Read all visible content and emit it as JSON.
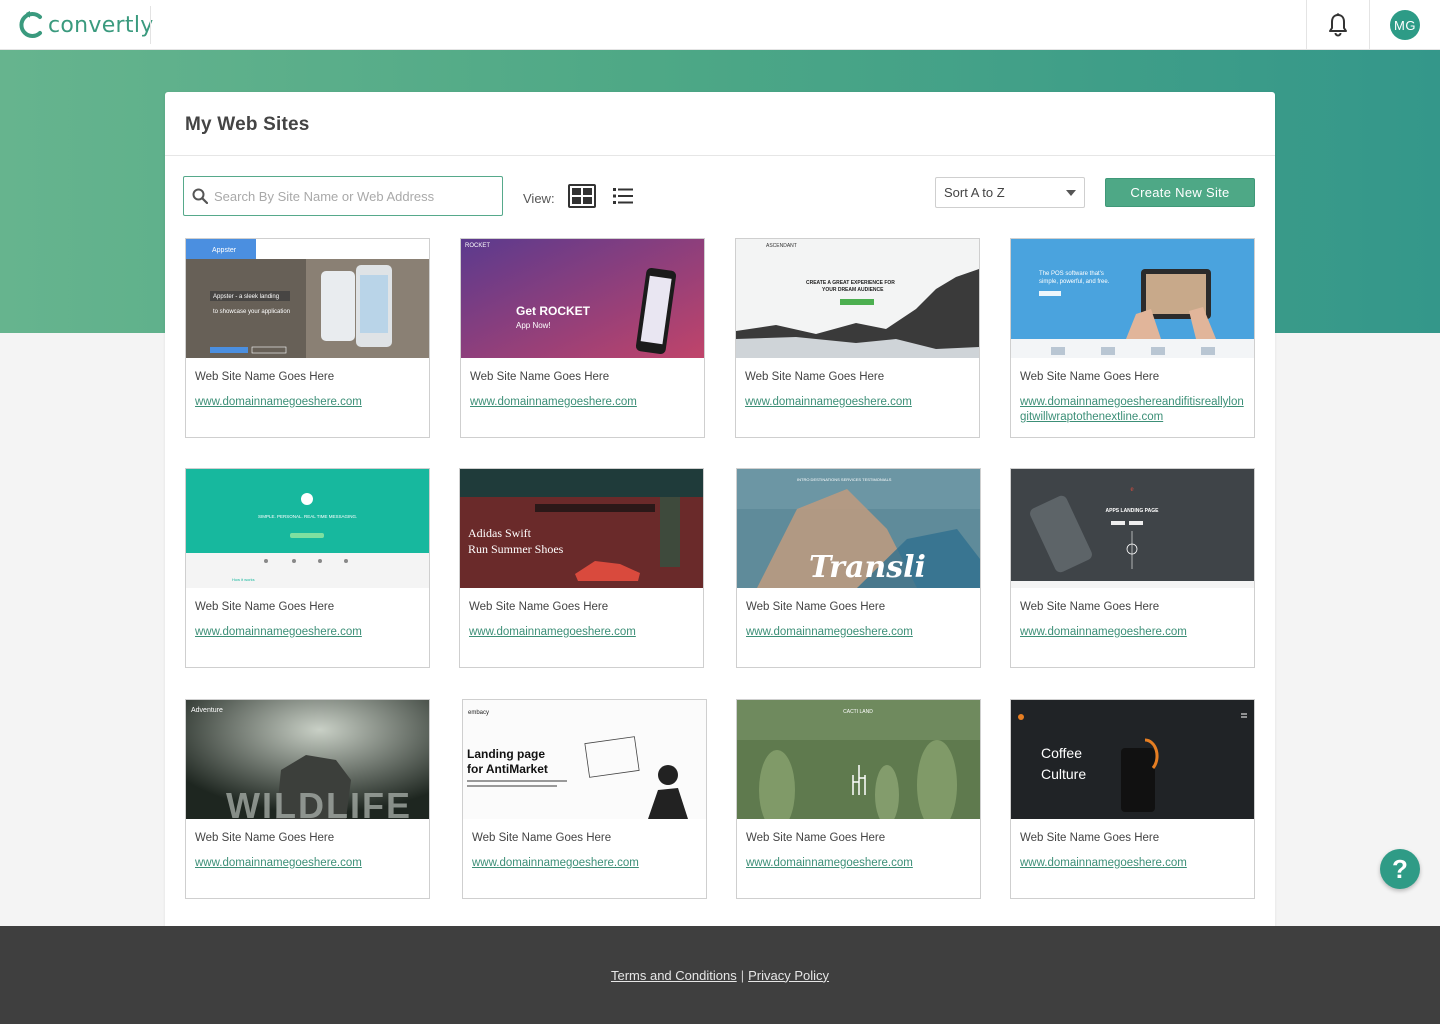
{
  "app": {
    "logo_text": "convertly",
    "user_initials": "MG",
    "brand_color": "#3a9a7e"
  },
  "page": {
    "title": "My Web Sites",
    "search_placeholder": "Search By Site Name or Web Address",
    "view_label": "View:",
    "sort_value": "Sort A to Z",
    "create_button": "Create New Site"
  },
  "sites": [
    {
      "name": "Web Site Name Goes Here",
      "url": "www.domainnamegoeshere.com",
      "thumb_text": "Appster - a sleek landing to showcase your application",
      "thumb_brand": "Appster"
    },
    {
      "name": "Web Site Name Goes Here",
      "url": "www.domainnamegoeshere.com",
      "thumb_text": "Get ROCKET",
      "thumb_sub": "App Now!",
      "thumb_brand": "ROCKET"
    },
    {
      "name": "Web Site Name Goes Here",
      "url": "www.domainnamegoeshere.com",
      "thumb_text": "CREATE A GREAT EXPERIENCE FOR YOUR DREAM AUDIENCE",
      "thumb_brand": "ASCENDANT"
    },
    {
      "name": "Web Site Name Goes Here",
      "url": "www.domainnamegoeshereandifitisreallylongitwillwraptothenextline.com",
      "thumb_text": "The POS software that's simple, powerful, and free."
    },
    {
      "name": "Web Site Name Goes Here",
      "url": "www.domainnamegoeshere.com",
      "thumb_text": "SIMPLE. PERSONAL. REAL TIME MESSAGING."
    },
    {
      "name": "Web Site Name Goes Here",
      "url": "www.domainnamegoeshere.com",
      "thumb_text": "Adidas Swift",
      "thumb_sub": "Run Summer Shoes"
    },
    {
      "name": "Web Site Name Goes Here",
      "url": "www.domainnamegoeshere.com",
      "thumb_text": "Transli"
    },
    {
      "name": "Web Site Name Goes Here",
      "url": "www.domainnamegoeshere.com",
      "thumb_text": "APPS LANDING PAGE"
    },
    {
      "name": "Web Site Name Goes Here",
      "url": "www.domainnamegoeshere.com",
      "thumb_text": "THE WILDLIFE",
      "thumb_brand": "Adventure"
    },
    {
      "name": "Web Site Name Goes Here",
      "url": "www.domainnamegoeshere.com",
      "thumb_text": "Landing page",
      "thumb_sub": "for AntiMarket",
      "thumb_brand": "embacy"
    },
    {
      "name": "Web Site Name Goes Here",
      "url": "www.domainnamegoeshere.com",
      "thumb_text": "CACTI LAND"
    },
    {
      "name": "Web Site Name Goes Here",
      "url": "www.domainnamegoeshere.com",
      "thumb_text": "Coffee",
      "thumb_sub": "Culture"
    }
  ],
  "footer": {
    "terms": "Terms and Conditions",
    "separator": "|",
    "privacy": "Privacy Policy"
  },
  "help_label": "?"
}
